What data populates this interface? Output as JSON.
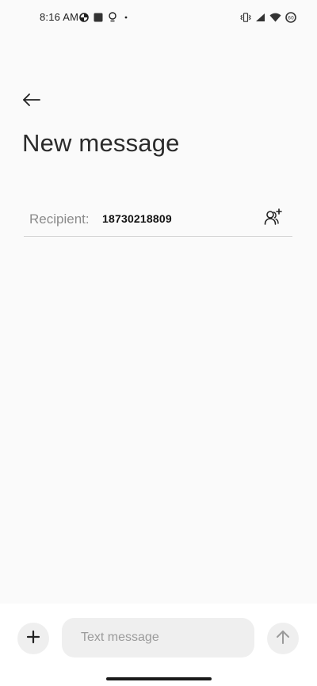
{
  "status_bar": {
    "time": "8:16 AM",
    "left_icons": [
      "data-saver-icon",
      "square-notification-icon",
      "lightbulb-icon",
      "dot-icon"
    ],
    "right_icons": [
      "vibrate-icon",
      "signal-icon",
      "wifi-icon",
      "battery-icon"
    ],
    "battery_level": "60"
  },
  "header": {
    "back_icon": "arrow-left-icon",
    "title": "New message"
  },
  "recipient": {
    "label": "Recipient:",
    "value": "18730218809",
    "add_contact_icon": "add-person-icon"
  },
  "compose": {
    "attach_icon": "plus-icon",
    "placeholder": "Text message",
    "send_icon": "arrow-up-icon"
  },
  "colors": {
    "background": "#fafafa",
    "field_background": "#efefef",
    "text_primary": "#2b2b2b",
    "text_secondary": "#8a8a8a"
  }
}
